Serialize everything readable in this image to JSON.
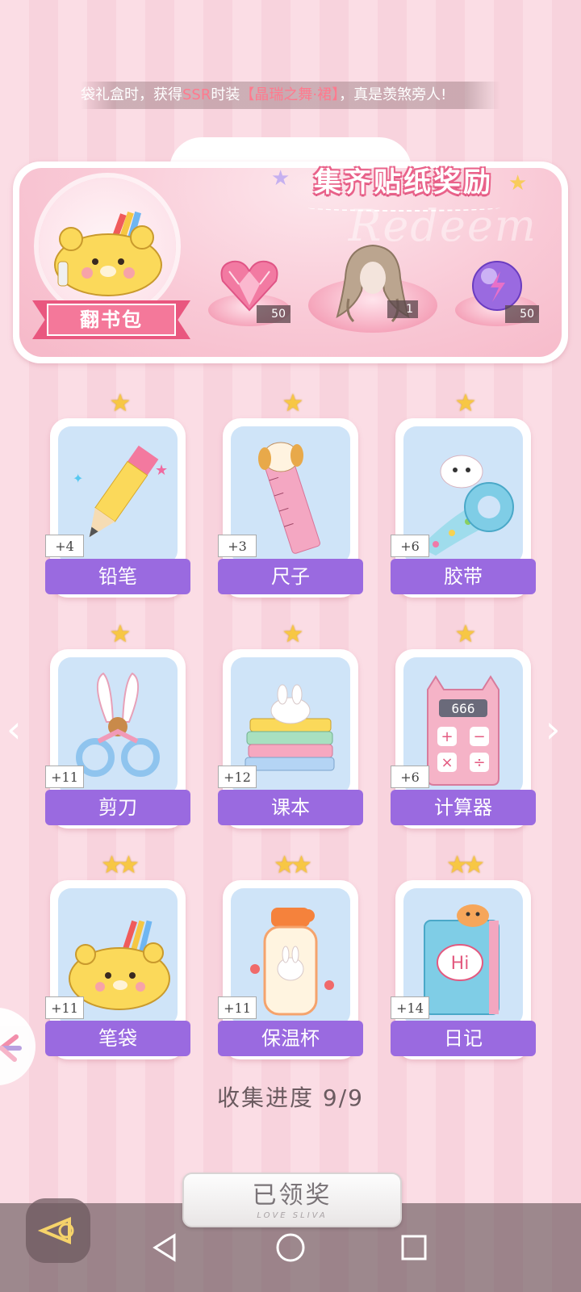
{
  "marquee": {
    "prefix": "袋礼盒时，获得",
    "hl1": "SSR",
    "mid": "时装",
    "hl2": "【晶瑞之舞·裙】",
    "suffix": "，真是羡煞旁人!"
  },
  "reward_panel": {
    "title": "集齐贴纸奖励",
    "watermark": "Redeem",
    "banner_label": "翻书包",
    "rewards": [
      {
        "name": "pink-heart-gem",
        "count": "50"
      },
      {
        "name": "hairstyle",
        "count": "1"
      },
      {
        "name": "purple-orb",
        "count": "50"
      }
    ]
  },
  "stickers": [
    {
      "label": "铅笔",
      "count": "+4",
      "stars": "★",
      "icon": "pencil-icon"
    },
    {
      "label": "尺子",
      "count": "+3",
      "stars": "★",
      "icon": "ruler-icon"
    },
    {
      "label": "胶带",
      "count": "+6",
      "stars": "★",
      "icon": "tape-icon"
    },
    {
      "label": "剪刀",
      "count": "+11",
      "stars": "★",
      "icon": "scissors-icon"
    },
    {
      "label": "课本",
      "count": "+12",
      "stars": "★",
      "icon": "books-icon"
    },
    {
      "label": "计算器",
      "count": "+6",
      "stars": "★",
      "icon": "calculator-icon",
      "calc_display": "666"
    },
    {
      "label": "笔袋",
      "count": "+11",
      "stars": "★★",
      "icon": "pencil-case-icon"
    },
    {
      "label": "保温杯",
      "count": "+11",
      "stars": "★★",
      "icon": "thermos-icon"
    },
    {
      "label": "日记",
      "count": "+14",
      "stars": "★★",
      "icon": "diary-icon",
      "diary_text": "Hi"
    }
  ],
  "progress": {
    "label": "收集进度",
    "value": "9/9"
  },
  "claim_button": {
    "label": "已领奖",
    "sub": "LOVE SLIVA"
  },
  "colors": {
    "accent": "#9a6ae0",
    "title_pink": "#e9628a",
    "bg": "#fbdde5"
  }
}
